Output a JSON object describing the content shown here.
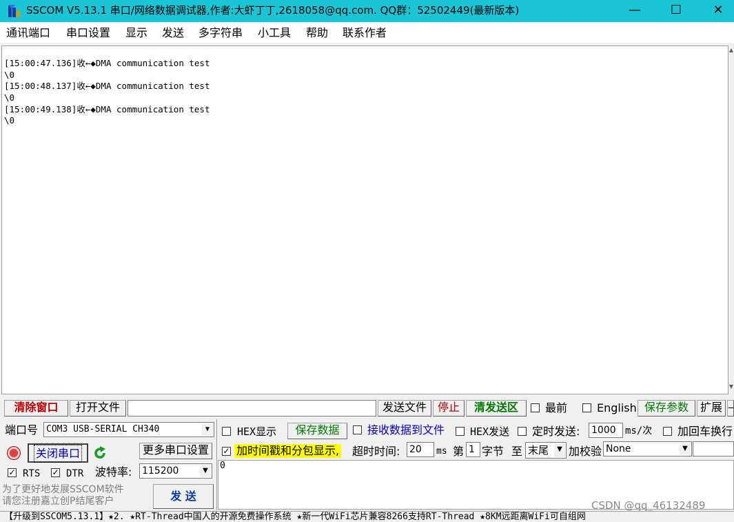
{
  "window": {
    "title": "SSCOM V5.13.1 串口/网络数据调试器,作者:大虾丁丁,2618058@qq.com. QQ群：52502449(最新版本)",
    "minimize": "—",
    "maximize": "☐",
    "close": "✕"
  },
  "menu": [
    "通讯端口",
    "串口设置",
    "显示",
    "发送",
    "多字符串",
    "小工具",
    "帮助",
    "联系作者"
  ],
  "receive": {
    "lines": [
      "[15:00:47.136]收←◆DMA communication test",
      "\\0",
      "[15:00:48.137]收←◆DMA communication test",
      "\\0",
      "[15:00:49.138]收←◆DMA communication test",
      "\\0"
    ]
  },
  "toolbar": {
    "clear_window": "清除窗口",
    "open_file": "打开文件",
    "file_path": "",
    "send_file": "发送文件",
    "stop": "停止",
    "clear_send": "清发送区",
    "latest_label": "最前",
    "english_label": "English",
    "save_params": "保存参数",
    "expand": "扩展",
    "dash": "—"
  },
  "port": {
    "port_label": "端口号",
    "port_value": "COM3 USB-SERIAL CH340",
    "close_port": "关闭串口",
    "more_settings": "更多串口设置",
    "rts_label": "RTS",
    "dtr_label": "DTR",
    "baud_label": "波特率:",
    "baud_value": "115200",
    "promo_line1": "为了更好地发展SSCOM软件",
    "promo_line2": "请您注册嘉立创P结尾客户",
    "send_button": "发 送"
  },
  "options": {
    "hex_display": "HEX显示",
    "save_data": "保存数据",
    "recv_to_file": "接收数据到文件",
    "hex_send": "HEX发送",
    "timed_send": "定时发送:",
    "timed_value": "1000",
    "timed_unit": "ms/次",
    "add_crlf": "加回车换行",
    "timestamp": "加时间戳和分包显示,",
    "timeout_label": "超时时间:",
    "timeout_value": "20",
    "timeout_unit": "ms",
    "byte_prefix": "第",
    "byte_value": "1",
    "byte_label": "字节",
    "to_label": "至",
    "to_value": "末尾",
    "checksum_label": "加校验",
    "checksum_value": "None"
  },
  "send_area": {
    "value": "0"
  },
  "status_bar": "【升级到SSCOM5.13.1】★2. ★RT-Thread中国人的开源免费操作系统 ★新一代WiFi芯片兼容8266支持RT-Thread ★8KM远距离WiFi可自组网",
  "watermark": "CSDN @qq_46132489",
  "colors": {
    "titlebar": "#1ac6d6",
    "red_text": "#c00000",
    "green_text": "#007a00",
    "blue_text": "#0000c8",
    "highlight": "#ffff00"
  }
}
